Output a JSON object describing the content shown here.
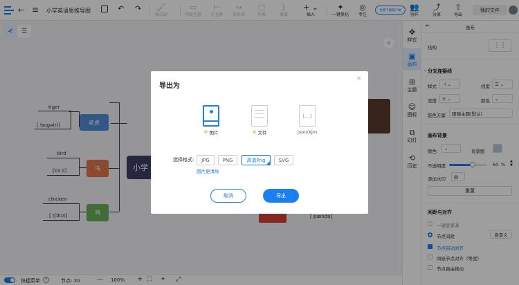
{
  "header": {
    "title": "小学英语思维导图",
    "free_download": "免费下载客户端",
    "my_files": "我的文件"
  },
  "toolbar": {
    "format_brush": "格式刷",
    "sibling_topic": "同级主题",
    "child_topic": "子主题",
    "relation": "关系线",
    "outline_box": "外框",
    "summary": "概要",
    "insert": "插入",
    "beautify": "一键美化",
    "focus": "专注",
    "collab": "协作",
    "share": "分享",
    "export": "导出"
  },
  "mindmap": {
    "center": "小学",
    "tiger": "老虎",
    "tiger_word": "tiger",
    "tiger_ipa": "[ taɪgə(r)]",
    "bird": "鸟",
    "bird_word": "bird",
    "bird_ipa": "[bɜ d]",
    "chicken": "鸡",
    "chicken_word": "chicken",
    "chicken_ipa": "[ tʃɪkɪn]",
    "panda_ipa": "[ pændə]"
  },
  "dialog": {
    "title": "导出为",
    "type_image": "图片",
    "type_file": "文件",
    "type_json": "Json/Xjm",
    "select_format": "选择格式:",
    "formats": [
      "JPG",
      "PNG",
      "高清Png",
      "SVG"
    ],
    "hd_link": "图片更清晰",
    "cancel": "取消",
    "confirm": "导出"
  },
  "side_tabs": [
    "样式",
    "画布",
    "主题",
    "图标",
    "幻灯",
    "历史"
  ],
  "panel": {
    "title": "画布",
    "structure": "结构",
    "branch_section": "分支连接线",
    "style": "样式",
    "line_type": "线型",
    "width": "宽度",
    "color": "颜色",
    "color_scheme": "配色方案",
    "color_scheme_value": "跟随主题(默认)",
    "bg_section": "画布背景",
    "bg_color": "颜色",
    "bg_image": "背景图",
    "opacity_label": "不透明度",
    "opacity_value": "60",
    "percent": "%",
    "watermark": "添加水印",
    "reset": "重置",
    "spacing_section": "间距与对齐",
    "compact": "一键变紧凑",
    "node_spacing": "节点间距",
    "custom": "自定义",
    "auto_align": "节点自动对齐",
    "sibling_align": "同级节点对齐（等宽）",
    "free_drag": "节点自由拖动"
  },
  "status": {
    "shortcut": "快捷菜单",
    "nodes": "节点: 20",
    "zoom": "100%"
  },
  "colors": {
    "accent": "#1b7ff0",
    "tiger": "#4f8fd8",
    "bird": "#e0784a",
    "chicken": "#6aad5a",
    "center": "#3a3f66"
  }
}
